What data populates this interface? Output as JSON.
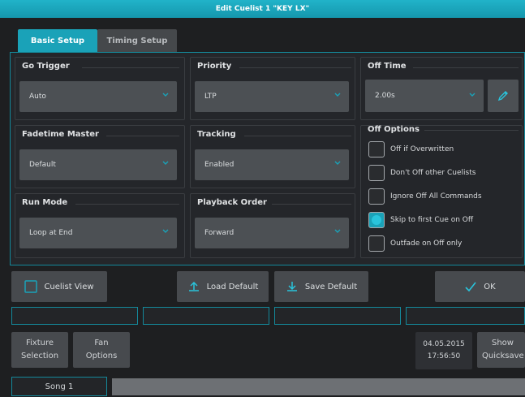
{
  "window": {
    "title": "Edit Cuelist 1 \"KEY LX\""
  },
  "tabs": [
    {
      "label": "Basic Setup"
    },
    {
      "label": "Timing Setup"
    }
  ],
  "groups": {
    "go_trigger": {
      "label": "Go Trigger",
      "value": "Auto"
    },
    "priority": {
      "label": "Priority",
      "value": "LTP"
    },
    "off_time": {
      "label": "Off Time",
      "value": "2.00s"
    },
    "fadetime_master": {
      "label": "Fadetime Master",
      "value": "Default"
    },
    "tracking": {
      "label": "Tracking",
      "value": "Enabled"
    },
    "run_mode": {
      "label": "Run Mode",
      "value": "Loop at End"
    },
    "playback_order": {
      "label": "Playback Order",
      "value": "Forward"
    }
  },
  "off_options": {
    "label": "Off Options",
    "items": [
      {
        "label": "Off if Overwritten",
        "checked": false
      },
      {
        "label": "Don't Off other Cuelists",
        "checked": false
      },
      {
        "label": "Ignore Off All Commands",
        "checked": false
      },
      {
        "label": "Skip to first Cue on Off",
        "checked": true
      },
      {
        "label": "Outfade on Off only",
        "checked": false
      }
    ]
  },
  "buttons": {
    "cuelist_view": "Cuelist View",
    "load_default": "Load Default",
    "save_default": "Save Default",
    "ok": "OK"
  },
  "footer": {
    "fixture_selection": [
      "Fixture",
      "Selection"
    ],
    "fan_options": [
      "Fan",
      "Options"
    ],
    "date": "04.05.2015",
    "time": "17:56:50",
    "show_quicksave": [
      "Show",
      "Quicksave"
    ],
    "song": "Song 1"
  },
  "colors": {
    "accent": "#1aa2b8",
    "title_bar": "#1aa8be",
    "panel": "#24262a"
  }
}
